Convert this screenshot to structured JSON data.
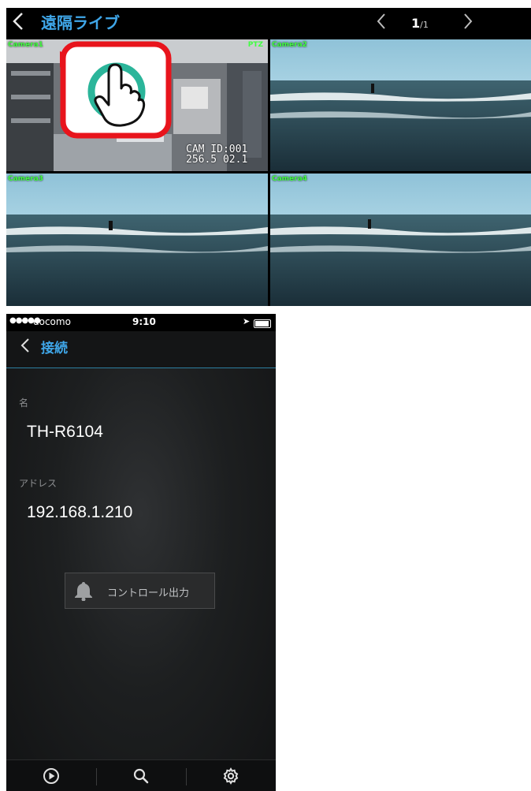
{
  "live_view": {
    "back_icon": "chevron-left-icon",
    "title": "遠隔ライブ",
    "pagination": {
      "prev_icon": "chevron-left-icon",
      "current": "1",
      "total": "/1",
      "next_icon": "chevron-right-icon"
    },
    "cameras": [
      {
        "label": "Camera1",
        "ptz": "PTZ",
        "osd_line1": "CAM ID:001",
        "osd_line2": "256.5 02.1"
      },
      {
        "label": "Camera2"
      },
      {
        "label": "Camera3"
      },
      {
        "label": "Camera4"
      }
    ],
    "callout_icon": "tap-hand-icon"
  },
  "phone": {
    "status_bar": {
      "signal": "●●●●●",
      "carrier": "docomo",
      "time": "9:10"
    },
    "nav": {
      "back_icon": "chevron-left-icon",
      "title": "接続"
    },
    "name_label": "名",
    "name_value": "TH-R6104",
    "address_label": "アドレス",
    "address_value": "192.168.1.210",
    "control_button": {
      "icon": "bell-icon",
      "label": "コントロール出力"
    },
    "tabs": [
      {
        "icon": "play-circle-icon"
      },
      {
        "icon": "search-icon"
      },
      {
        "icon": "gear-icon"
      }
    ]
  },
  "colors": {
    "accent": "#3fa6e8",
    "cam_label": "#40ff40",
    "callout": "#e8141c"
  }
}
